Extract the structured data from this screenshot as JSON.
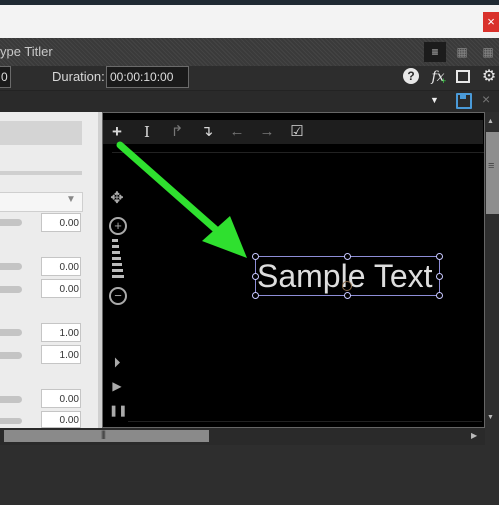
{
  "window": {
    "title": "ype Titler",
    "close_glyph": "×"
  },
  "toolbar": {
    "start_value": "0",
    "duration_label": "Duration:",
    "duration_value": "00:00:10:00",
    "help_glyph": "?",
    "fx_glyph": "fx",
    "fx_plus_glyph": "+",
    "gear_glyph": "⚙",
    "view_icons": [
      "≡",
      "▦",
      "▦"
    ]
  },
  "preset": {
    "dropdown_glyph": "▼",
    "close_glyph": "×"
  },
  "left_panel": {
    "dropdown_glyph": "▼",
    "values": [
      "0.00",
      "0.00",
      "0.00",
      "1.00",
      "1.00",
      "0.00",
      "0.00"
    ]
  },
  "canvas": {
    "toolbar_icons": [
      "+",
      "I",
      "↱",
      "↴",
      "←",
      "→",
      "☑"
    ],
    "tools": {
      "move_glyph": "✥",
      "zoom_in_glyph": "+",
      "zoom_out_glyph": "−",
      "step_glyph": "⏵",
      "play_glyph": "▶",
      "pause_glyph": "❚❚"
    },
    "sample_text": "Sample Text"
  },
  "scrollbars": {
    "up_glyph": "▲",
    "down_glyph": "▼",
    "right_glyph": "▶",
    "grip_glyph": "|||",
    "vgrip_glyph": "≡"
  },
  "colors": {
    "close_button": "#d9312b",
    "annotation_arrow": "#2fe02f",
    "selection_border": "#8d8dd6"
  }
}
